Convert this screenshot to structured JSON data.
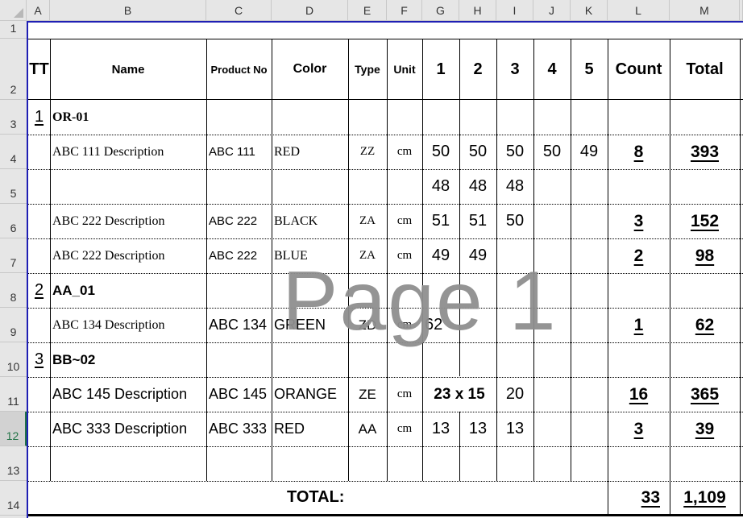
{
  "spreadsheet": {
    "column_headers": [
      "A",
      "B",
      "C",
      "D",
      "E",
      "F",
      "G",
      "H",
      "I",
      "J",
      "K",
      "L",
      "M"
    ],
    "row_headers": [
      "1",
      "2",
      "3",
      "4",
      "5",
      "6",
      "7",
      "8",
      "9",
      "10",
      "11",
      "12",
      "13",
      "14"
    ],
    "selected_row": "12",
    "watermark": "Page 1"
  },
  "table": {
    "headers": {
      "tt": "TT",
      "name": "Name",
      "product_no": "Product No",
      "color": "Color",
      "type": "Type",
      "unit": "Unit",
      "m1": "1",
      "m2": "2",
      "m3": "3",
      "m4": "4",
      "m5": "5",
      "count": "Count",
      "total": "Total"
    },
    "groups": [
      {
        "index": "1",
        "name": "OR-01"
      },
      {
        "index": "2",
        "name": "AA_01"
      },
      {
        "index": "3",
        "name": "BB~02"
      }
    ],
    "rows": [
      {
        "name": "ABC 111 Description",
        "product_no": "ABC 111",
        "color": "RED",
        "type": "ZZ",
        "unit": "cm",
        "m1": "50",
        "m2": "50",
        "m3": "50",
        "m4": "50",
        "m5": "49",
        "count": "8",
        "total": "393"
      },
      {
        "name": "",
        "product_no": "",
        "color": "",
        "type": "",
        "unit": "",
        "m1": "48",
        "m2": "48",
        "m3": "48",
        "m4": "",
        "m5": "",
        "count": "",
        "total": ""
      },
      {
        "name": "ABC 222 Description",
        "product_no": "ABC 222",
        "color": "BLACK",
        "type": "ZA",
        "unit": "cm",
        "m1": "51",
        "m2": "51",
        "m3": "50",
        "m4": "",
        "m5": "",
        "count": "3",
        "total": "152"
      },
      {
        "name": "ABC 222 Description",
        "product_no": "ABC 222",
        "color": "BLUE",
        "type": "ZA",
        "unit": "cm",
        "m1": "49",
        "m2": "49",
        "m3": "",
        "m4": "",
        "m5": "",
        "count": "2",
        "total": "98"
      },
      {
        "name": "ABC 134 Description",
        "product_no": "ABC 134",
        "color": "GREEN",
        "type": "ZD",
        "unit": "cm",
        "m1": "62",
        "m2": "",
        "m3": "",
        "m4": "",
        "m5": "",
        "count": "1",
        "total": "62"
      },
      {
        "name": "ABC 145 Description",
        "product_no": "ABC 145",
        "color": "ORANGE",
        "type": "ZE",
        "unit": "cm",
        "m12_merged": "23 x 15",
        "m3": "20",
        "m4": "",
        "m5": "",
        "count": "16",
        "total": "365"
      },
      {
        "name": "ABC 333 Description",
        "product_no": "ABC 333",
        "color": "RED",
        "type": "AA",
        "unit": "cm",
        "m1": "13",
        "m2": "13",
        "m3": "13",
        "m4": "",
        "m5": "",
        "count": "3",
        "total": "39"
      }
    ],
    "footer": {
      "label": "TOTAL:",
      "count": "33",
      "total": "1,109"
    }
  }
}
